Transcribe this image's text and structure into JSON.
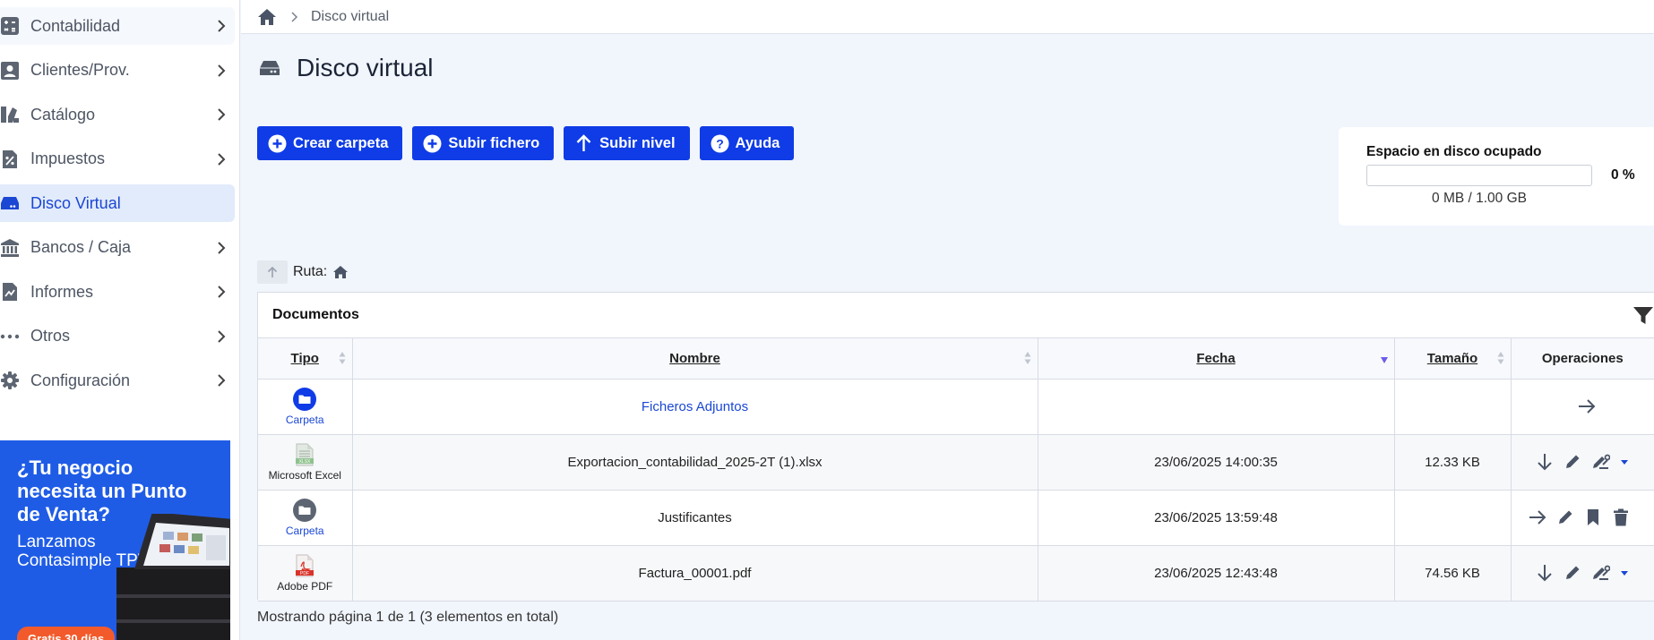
{
  "sidebar": {
    "items": [
      {
        "label": "Contabilidad",
        "icon": "calculator-icon",
        "active": false,
        "has_chevron": true
      },
      {
        "label": "Clientes/Prov.",
        "icon": "contact-card-icon",
        "active": false,
        "has_chevron": true
      },
      {
        "label": "Catálogo",
        "icon": "catalog-icon",
        "active": false,
        "has_chevron": true
      },
      {
        "label": "Impuestos",
        "icon": "percent-document-icon",
        "active": false,
        "has_chevron": true
      },
      {
        "label": "Disco Virtual",
        "icon": "hard-drive-icon",
        "active": true,
        "has_chevron": false
      },
      {
        "label": "Bancos / Caja",
        "icon": "bank-icon",
        "active": false,
        "has_chevron": true
      },
      {
        "label": "Informes",
        "icon": "chart-document-icon",
        "active": false,
        "has_chevron": true
      },
      {
        "label": "Otros",
        "icon": "ellipsis-icon",
        "active": false,
        "has_chevron": true
      },
      {
        "label": "Configuración",
        "icon": "gear-icon",
        "active": false,
        "has_chevron": true
      }
    ]
  },
  "promo": {
    "title": "¿Tu negocio necesita un Punto de Venta?",
    "subtitle": "Lanzamos Contasimple TPV",
    "cta": "Gratis 30 días"
  },
  "breadcrumb": {
    "current": "Disco virtual"
  },
  "page": {
    "title": "Disco virtual"
  },
  "toolbar": {
    "create_folder": "Crear carpeta",
    "upload_file": "Subir fichero",
    "level_up": "Subir nivel",
    "help": "Ayuda"
  },
  "disk": {
    "label": "Espacio en disco ocupado",
    "percent_text": "0 %",
    "usage_fraction": 0,
    "usage_text": "0 MB / 1.00 GB"
  },
  "route": {
    "label": "Ruta:"
  },
  "documents": {
    "title": "Documentos",
    "columns": {
      "type": "Tipo",
      "name": "Nombre",
      "date": "Fecha",
      "size": "Tamaño",
      "ops": "Operaciones"
    },
    "rows": [
      {
        "type": "Carpeta",
        "name": "Ficheros Adjuntos",
        "date": "",
        "size": ""
      },
      {
        "type": "Microsoft Excel",
        "name": "Exportacion_contabilidad_2025-2T (1).xlsx",
        "date": "23/06/2025 14:00:35",
        "size": "12.33 KB"
      },
      {
        "type": "Carpeta",
        "name": "Justificantes",
        "date": "23/06/2025 13:59:48",
        "size": ""
      },
      {
        "type": "Adobe PDF",
        "name": "Factura_00001.pdf",
        "date": "23/06/2025 12:43:48",
        "size": "74.56 KB"
      }
    ]
  },
  "pager": {
    "text": "Mostrando página 1 de 1 (3 elementos en total)"
  },
  "colors": {
    "primary": "#0f3ce6",
    "link": "#1a47d4",
    "promo_bg": "#1f5ce6",
    "cta": "#f25a2b"
  }
}
